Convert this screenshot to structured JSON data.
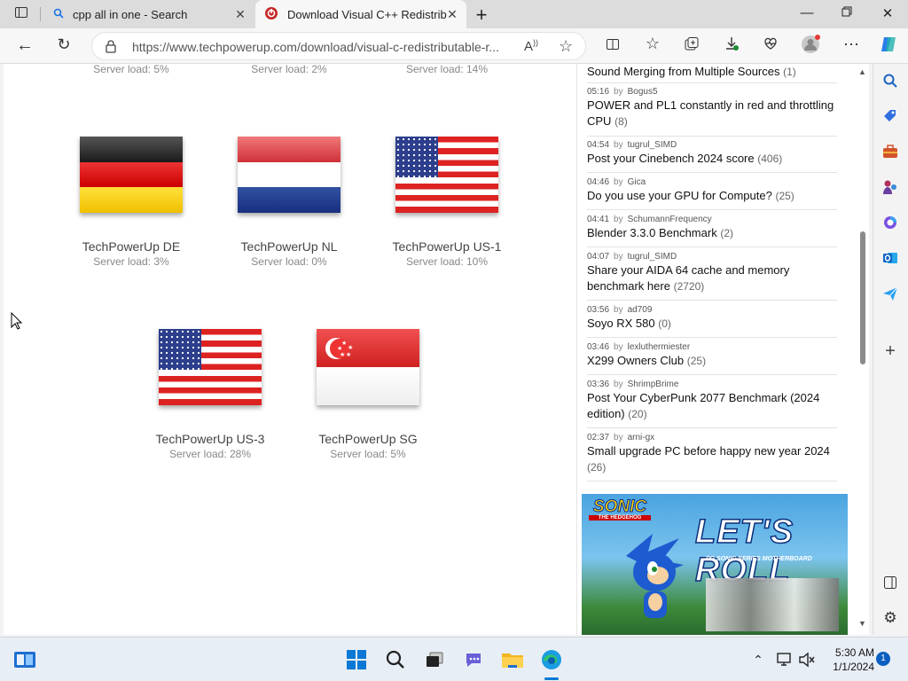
{
  "tabs": [
    {
      "title": "cpp all in one - Search",
      "icon": "search-icon"
    },
    {
      "title": "Download Visual C++ Redistributable",
      "icon": "techpowerup-icon"
    }
  ],
  "address": {
    "url": "https://www.techpowerup.com/download/visual-c-redistributable-r..."
  },
  "servers_top": [
    {
      "load": "Server load: 5%"
    },
    {
      "load": "Server load: 2%"
    },
    {
      "load": "Server load: 14%"
    }
  ],
  "servers": [
    {
      "name": "TechPowerUp DE",
      "load": "Server load: 3%",
      "flag": "germany"
    },
    {
      "name": "TechPowerUp NL",
      "load": "Server load: 0%",
      "flag": "netherlands"
    },
    {
      "name": "TechPowerUp US-1",
      "load": "Server load: 10%",
      "flag": "usa"
    },
    {
      "name": "TechPowerUp US-3",
      "load": "Server load: 28%",
      "flag": "usa"
    },
    {
      "name": "TechPowerUp SG",
      "load": "Server load: 5%",
      "flag": "singapore"
    }
  ],
  "forum": [
    {
      "time": "",
      "by": "",
      "author": "",
      "title": "Sound Merging from Multiple Sources",
      "count": "(1)"
    },
    {
      "time": "05:16",
      "by": "by",
      "author": "Bogus5",
      "title": "POWER and PL1 constantly in red and throttling CPU",
      "count": "(8)"
    },
    {
      "time": "04:54",
      "by": "by",
      "author": "tugrul_SIMD",
      "title": "Post your Cinebench 2024 score",
      "count": "(406)"
    },
    {
      "time": "04:46",
      "by": "by",
      "author": "Gica",
      "title": "Do you use your GPU for Compute?",
      "count": "(25)"
    },
    {
      "time": "04:41",
      "by": "by",
      "author": "SchumannFrequency",
      "title": "Blender 3.3.0 Benchmark",
      "count": "(2)"
    },
    {
      "time": "04:07",
      "by": "by",
      "author": "tugrul_SIMD",
      "title": "Share your AIDA 64 cache and memory benchmark here",
      "count": "(2720)"
    },
    {
      "time": "03:56",
      "by": "by",
      "author": "ad709",
      "title": "Soyo RX 580",
      "count": "(0)"
    },
    {
      "time": "03:46",
      "by": "by",
      "author": "lexluthermiester",
      "title": "X299 Owners Club",
      "count": "(25)"
    },
    {
      "time": "03:36",
      "by": "by",
      "author": "ShrimpBrime",
      "title": "Post Your CyberPunk 2077 Benchmark (2024 edition)",
      "count": "(20)"
    },
    {
      "time": "02:37",
      "by": "by",
      "author": "arni-gx",
      "title": "Small upgrade PC before happy new year 2024",
      "count": "(26)"
    }
  ],
  "ad": {
    "brand": "SONIC",
    "brand_sub": "THE HEDGEHOG",
    "headline": "LET'S ROLL",
    "sub": "PG SONIC SERIES MOTHERBOARD"
  },
  "clock": {
    "time": "5:30 AM",
    "date": "1/1/2024"
  },
  "notifications": {
    "count": "1"
  }
}
